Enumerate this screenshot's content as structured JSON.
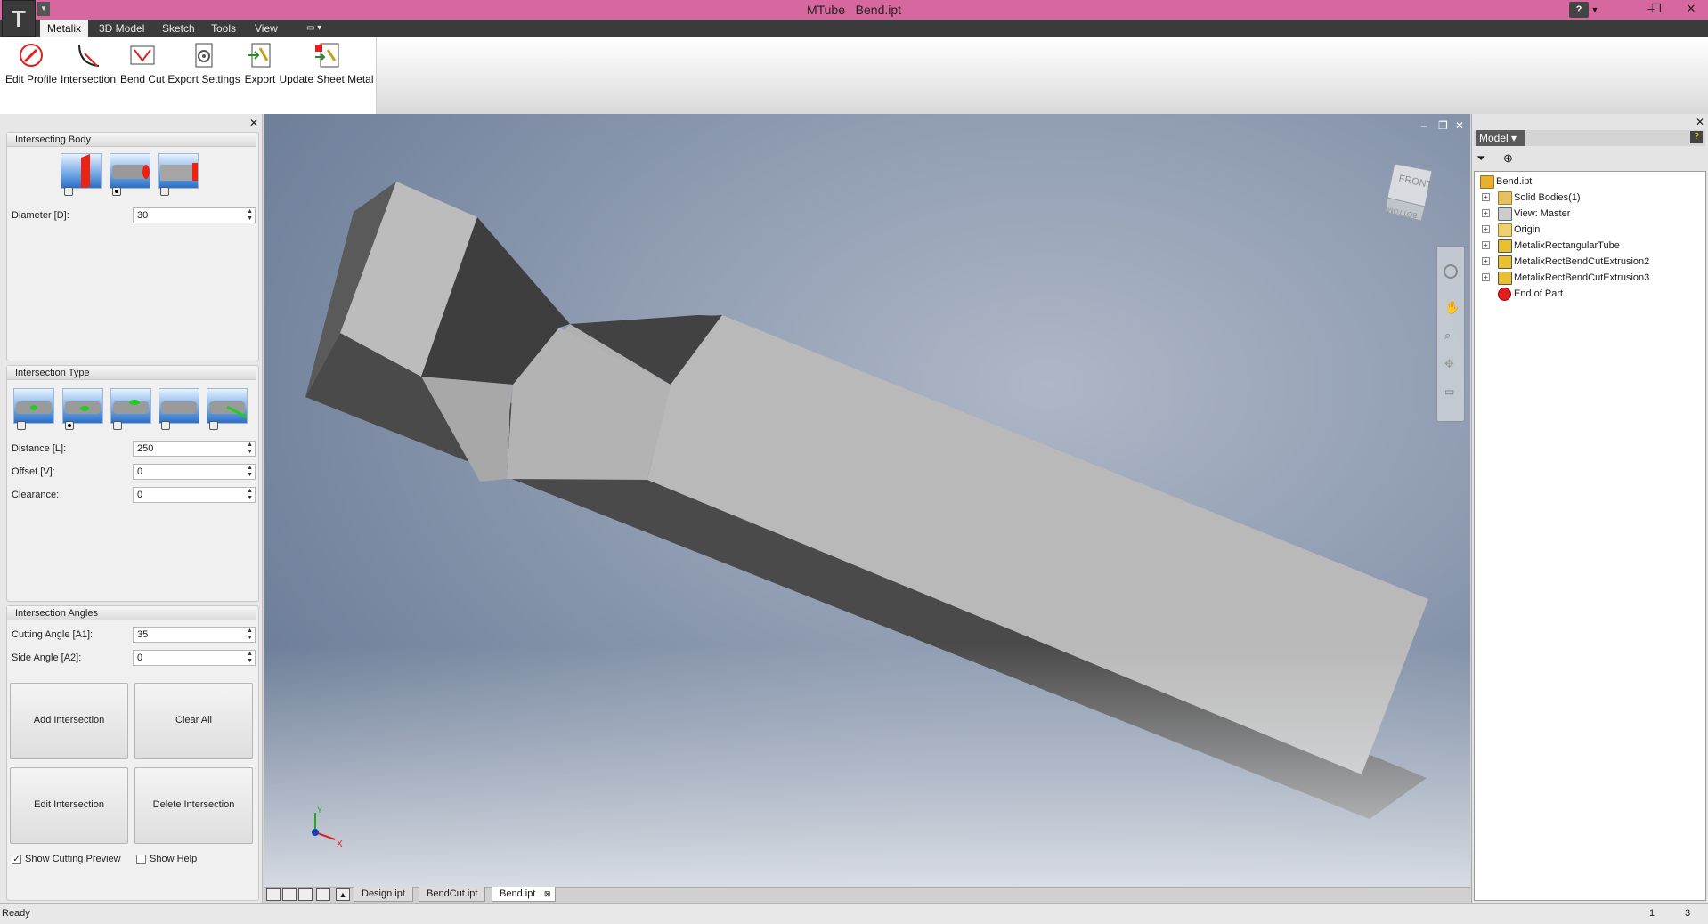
{
  "window": {
    "app_name": "MTube",
    "document": "Bend.ipt",
    "help_label": "?"
  },
  "menu": {
    "tabs": [
      "Metalix",
      "3D Model",
      "Sketch",
      "Tools",
      "View"
    ]
  },
  "ribbon": {
    "buttons": [
      "Edit Profile",
      "Intersection",
      "Bend Cut",
      "Export Settings",
      "Export",
      "Update Sheet Metal"
    ]
  },
  "left_panel": {
    "intersecting_body": {
      "title": "Intersecting Body",
      "selected_index": 1,
      "diameter_label": "Diameter [D]:",
      "diameter_value": "30"
    },
    "intersection_type": {
      "title": "Intersection Type",
      "selected_index": 1,
      "distance_label": "Distance [L]:",
      "distance_value": "250",
      "offset_label": "Offset [V]:",
      "offset_value": "0",
      "clearance_label": "Clearance:",
      "clearance_value": "0"
    },
    "intersection_angles": {
      "title": "Intersection Angles",
      "cutting_label": "Cutting Angle [A1]:",
      "cutting_value": "35",
      "side_label": "Side Angle [A2]:",
      "side_value": "0"
    },
    "buttons": {
      "add": "Add Intersection",
      "clear": "Clear All",
      "edit": "Edit Intersection",
      "delete": "Delete Intersection"
    },
    "checkboxes": {
      "show_cutting_preview": "Show Cutting Preview",
      "show_cutting_preview_checked": true,
      "show_help": "Show Help",
      "show_help_checked": false
    }
  },
  "viewcube": {
    "front": "FRONT",
    "bottom": "BOTTOM"
  },
  "axis": {
    "x": "X",
    "y": "Y"
  },
  "doc_tabs": [
    "Design.ipt",
    "BendCut.ipt",
    "Bend.ipt"
  ],
  "browser": {
    "title": "Model",
    "tree": [
      {
        "label": "Bend.ipt",
        "icon": "part-icon"
      },
      {
        "label": "Solid Bodies(1)",
        "icon": "folder-icon"
      },
      {
        "label": "View: Master",
        "icon": "view-icon"
      },
      {
        "label": "Origin",
        "icon": "folder-icon"
      },
      {
        "label": "MetalixRectangularTube",
        "icon": "feature-icon"
      },
      {
        "label": "MetalixRectBendCutExtrusion2",
        "icon": "feature-icon"
      },
      {
        "label": "MetalixRectBendCutExtrusion3",
        "icon": "feature-icon"
      },
      {
        "label": "End of Part",
        "icon": "end-icon"
      }
    ]
  },
  "status": {
    "text": "Ready",
    "num1": "1",
    "num2": "3"
  },
  "colors": {
    "title_bar": "#d6689f",
    "menu_bar": "#3b3b3b",
    "tube_face": "#b9b9b9",
    "tube_side": "#4a4a4a"
  }
}
